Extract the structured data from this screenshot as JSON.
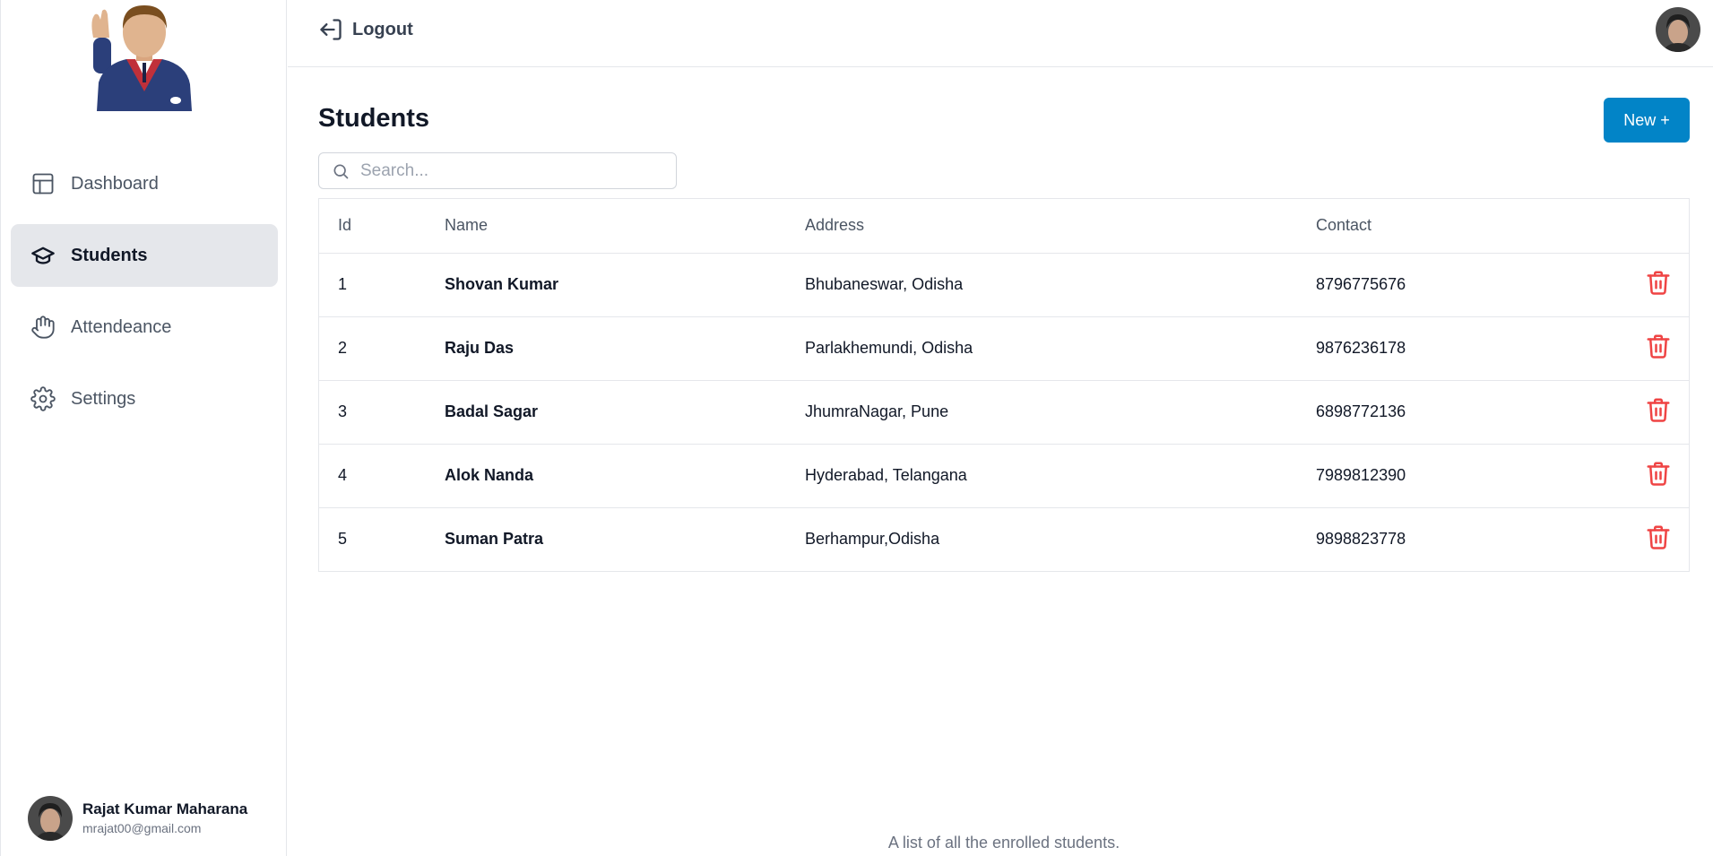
{
  "sidebar": {
    "logo_icon": "waving-student-avatar",
    "items": [
      {
        "label": "Dashboard",
        "icon": "layout-icon",
        "active": false
      },
      {
        "label": "Students",
        "icon": "graduation-cap-icon",
        "active": true
      },
      {
        "label": "Attendeance",
        "icon": "hand-icon",
        "active": false
      },
      {
        "label": "Settings",
        "icon": "gear-icon",
        "active": false
      }
    ],
    "profile": {
      "name": "Rajat Kumar Maharana",
      "email": "mrajat00@gmail.com"
    }
  },
  "header": {
    "logout_label": "Logout"
  },
  "main": {
    "title": "Students",
    "new_button_label": "New +",
    "search_placeholder": "Search...",
    "columns": [
      "Id",
      "Name",
      "Address",
      "Contact"
    ],
    "rows": [
      {
        "id": "1",
        "name": "Shovan Kumar",
        "address": "Bhubaneswar, Odisha",
        "contact": "8796775676"
      },
      {
        "id": "2",
        "name": "Raju Das",
        "address": "Parlakhemundi, Odisha",
        "contact": "9876236178"
      },
      {
        "id": "3",
        "name": "Badal Sagar",
        "address": "JhumraNagar, Pune",
        "contact": "6898772136"
      },
      {
        "id": "4",
        "name": "Alok Nanda",
        "address": "Hyderabad, Telangana",
        "contact": "7989812390"
      },
      {
        "id": "5",
        "name": "Suman Patra",
        "address": "Berhampur,Odisha",
        "contact": "9898823778"
      }
    ],
    "caption": "A list of all the enrolled students."
  },
  "colors": {
    "accent": "#0284c7",
    "danger": "#ef4444",
    "active_bg": "#e5e7eb"
  }
}
